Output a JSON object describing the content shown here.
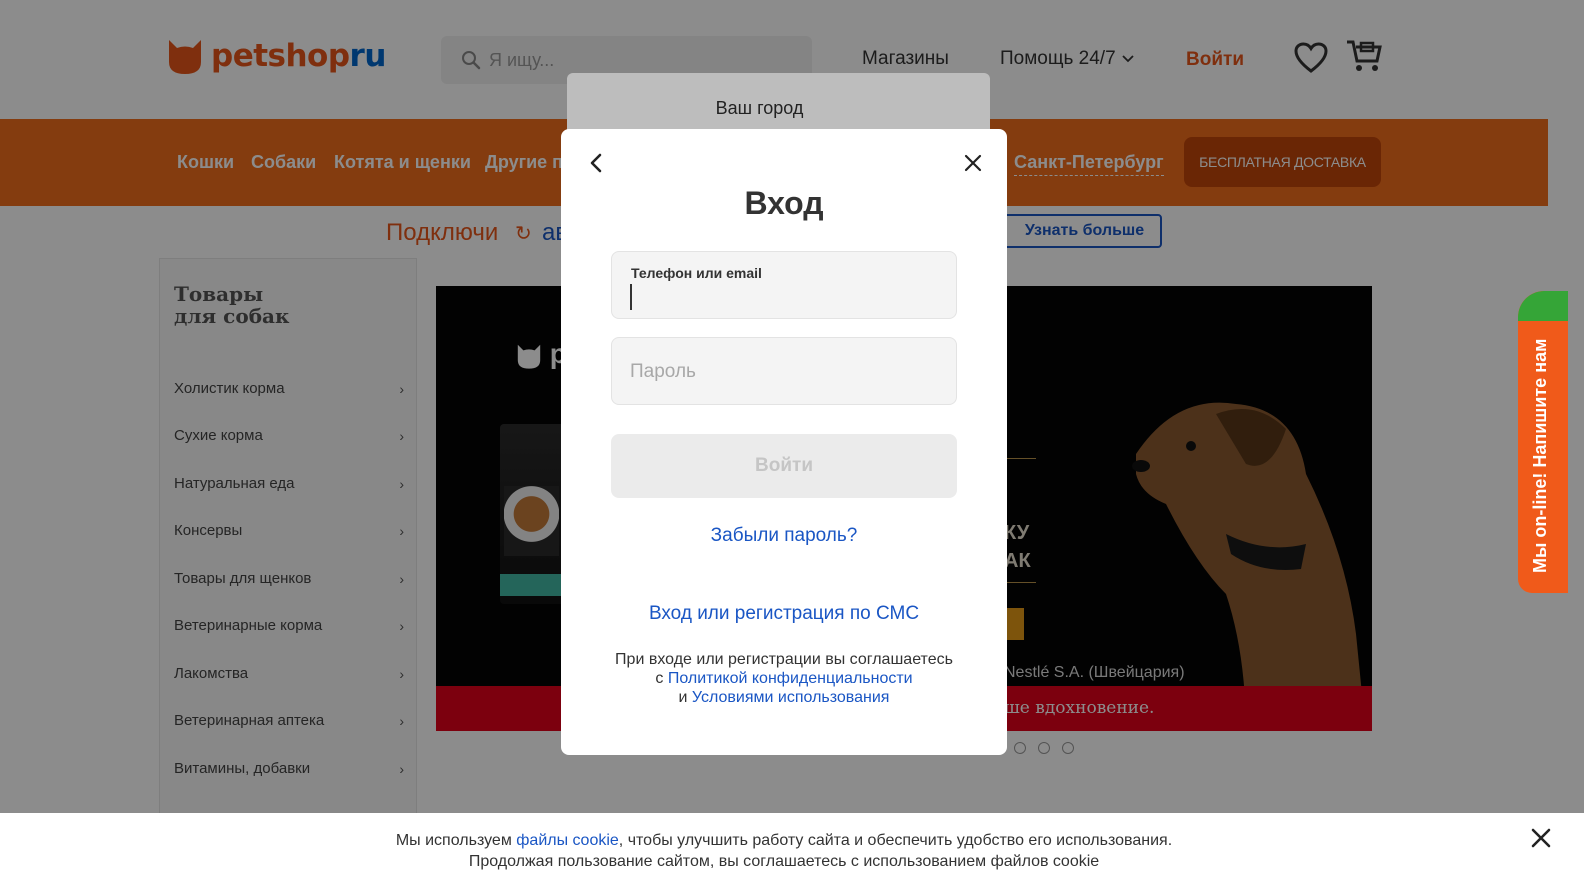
{
  "header": {
    "logo_part1": "petshop",
    "logo_part2": "ru",
    "search_placeholder": "Я ищу...",
    "nav_shops": "Магазины",
    "nav_help": "Помощь 24/7",
    "nav_login": "Войти",
    "brand_color": "#e8571a"
  },
  "category_nav": {
    "items": [
      "Кошки",
      "Собаки",
      "Котята и щенки",
      "Другие п"
    ],
    "city": "Санкт-Петербург",
    "free_delivery": "БЕСПЛАТНАЯ ДОСТАВКА",
    "bar_color": "#f06d1c"
  },
  "promo": {
    "text1": "Подключи",
    "text2": "ав",
    "more_button": "Узнать больше"
  },
  "sidebar": {
    "title_line1": "Товары",
    "title_line2": "для собак",
    "items": [
      {
        "label": "Холистик корма"
      },
      {
        "label": "Сухие корма"
      },
      {
        "label": "Натуральная еда"
      },
      {
        "label": "Консервы"
      },
      {
        "label": "Товары для щенков"
      },
      {
        "label": "Ветеринарные корма"
      },
      {
        "label": "Лакомства"
      },
      {
        "label": "Ветеринарная аптека"
      },
      {
        "label": "Витамины, добавки"
      }
    ]
  },
  "banner": {
    "logo_fragment": "p",
    "text_ky": "КУ",
    "text_ak": "АК",
    "nestle": "Nestlé S.A. (Швейцария)",
    "red_strip_text": "ше вдохновение."
  },
  "city_popup": {
    "title": "Ваш город"
  },
  "login_modal": {
    "title": "Вход",
    "phone_label": "Телефон или email",
    "phone_value": "",
    "password_placeholder": "Пароль",
    "login_button": "Войти",
    "forgot_link": "Забыли пароль?",
    "sms_link": "Вход или регистрация по СМС",
    "terms_line1": "При входе или регистрации вы соглашаетесь",
    "terms_with": "с",
    "terms_privacy": "Политикой конфиденциальности",
    "terms_and": "и",
    "terms_usage": "Условиями использования"
  },
  "chat_tab": {
    "label": "Мы on-line! Напишите нам"
  },
  "cookie_bar": {
    "text_before": "Мы используем ",
    "link": "файлы cookie",
    "text_after": ", чтобы улучшить работу сайта и обеспечить удобство его использования.",
    "line2": "Продолжая пользование сайтом, вы соглашаетесь с использованием файлов cookie"
  }
}
